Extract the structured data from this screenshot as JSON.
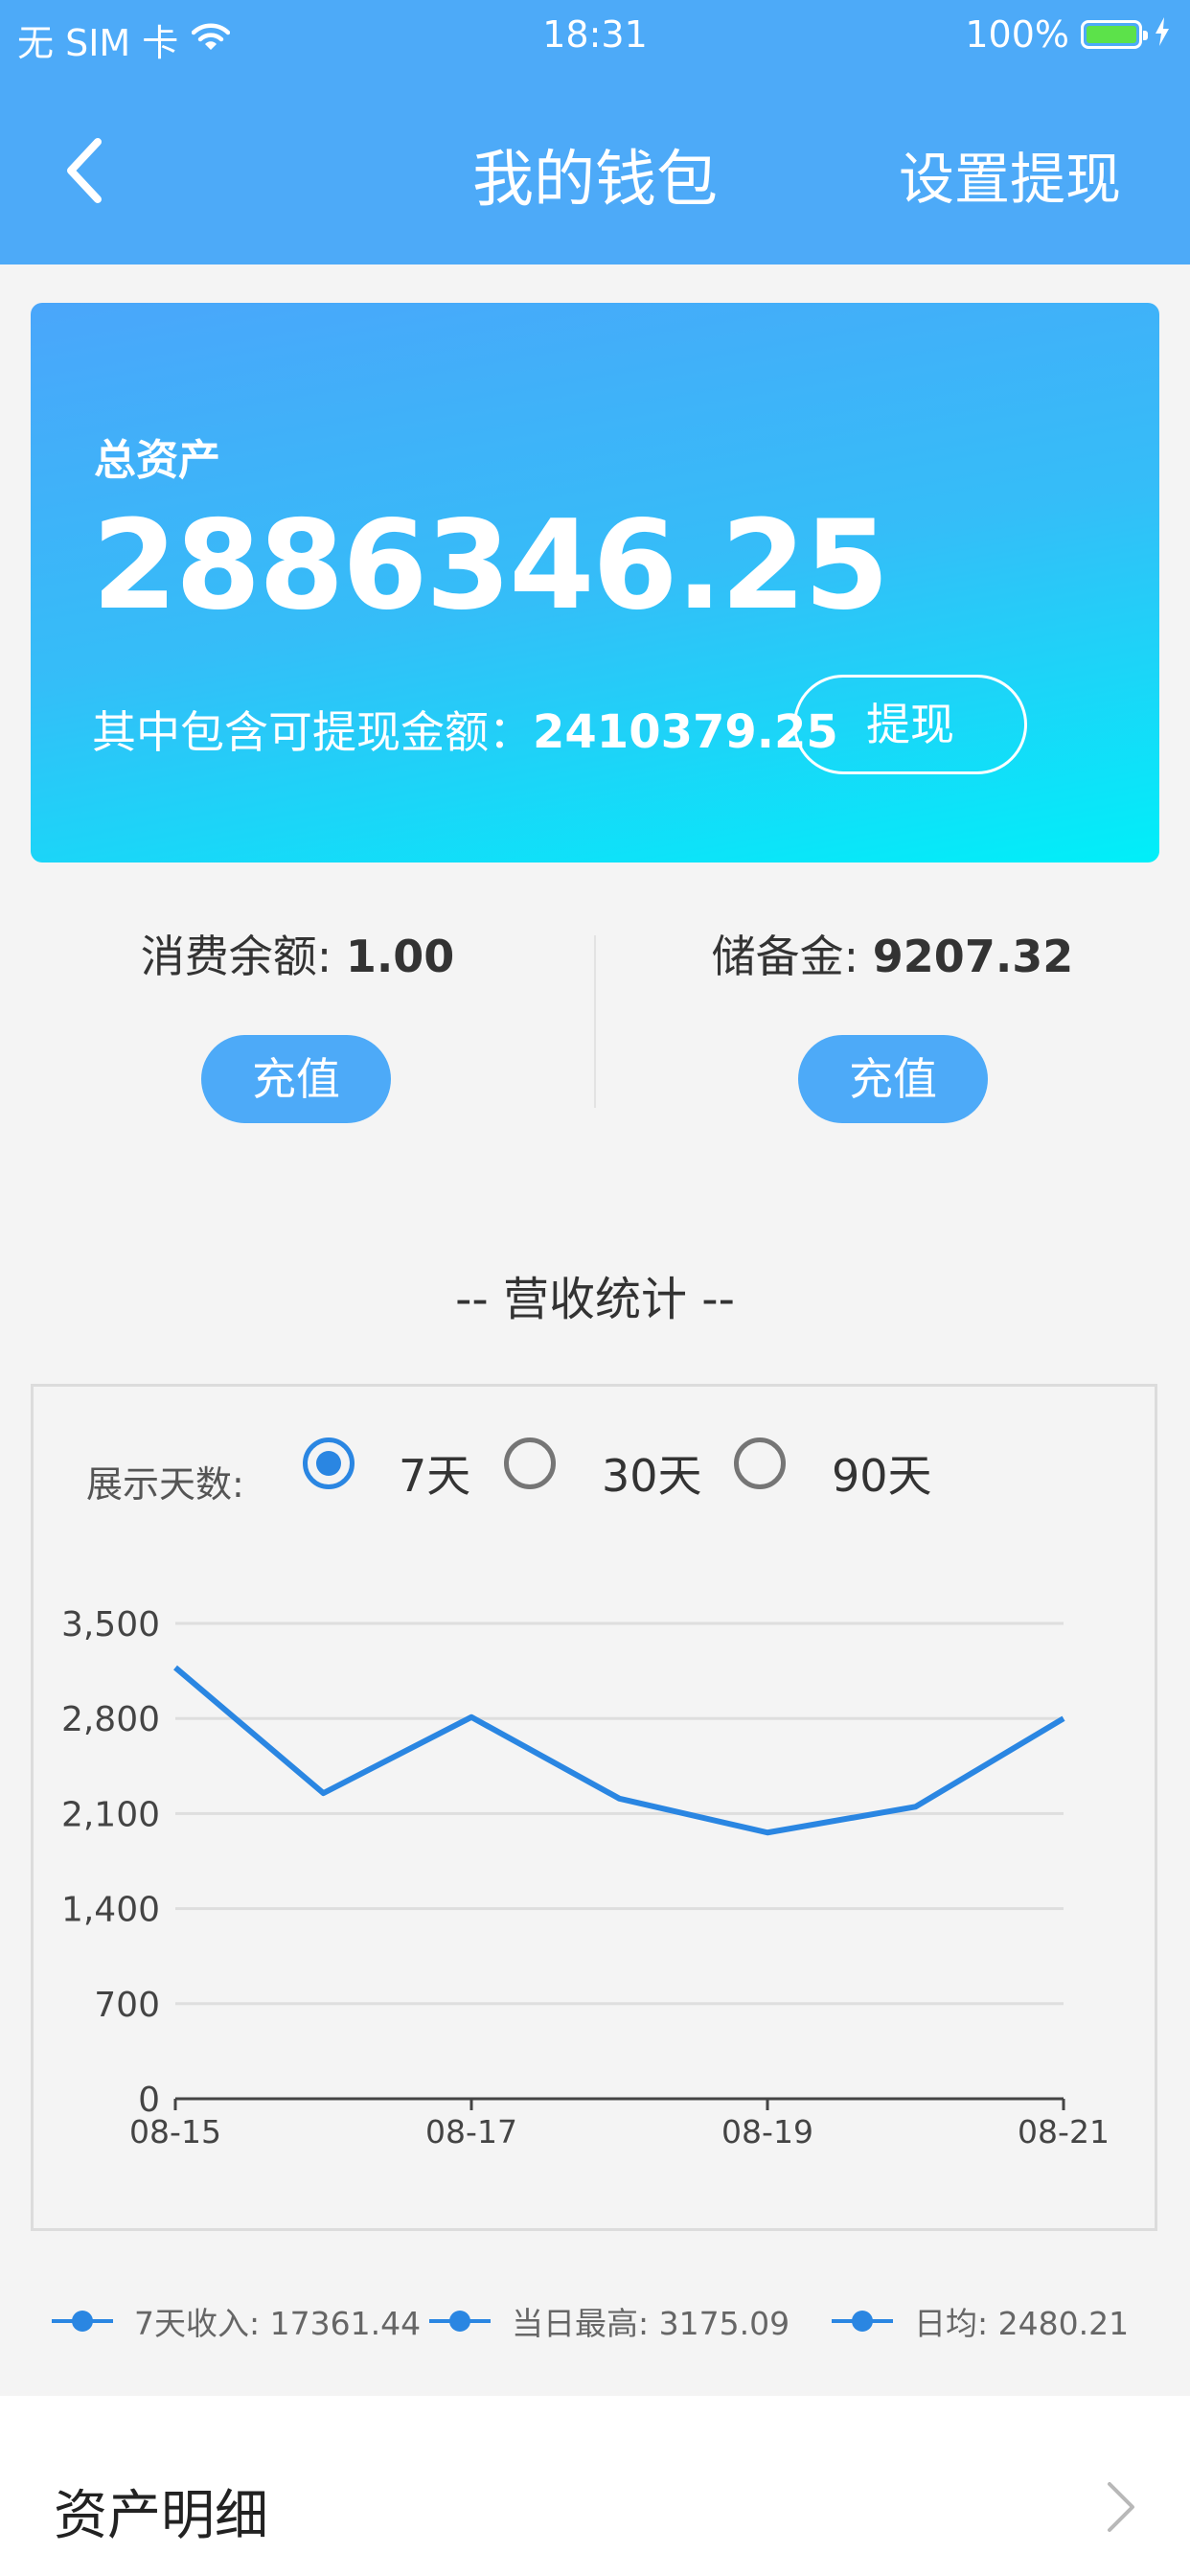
{
  "status_bar": {
    "carrier": "无 SIM 卡",
    "time": "18:31",
    "battery": "100%"
  },
  "nav": {
    "title": "我的钱包",
    "action": "设置提现"
  },
  "asset_card": {
    "label": "总资产",
    "total": "2886346.25",
    "withdrawable_label": "其中包含可提现金额：",
    "withdrawable_value": "2410379.25",
    "withdraw_button": "提现"
  },
  "balances": {
    "consume_label": "消费余额: ",
    "consume_value": "1.00",
    "reserve_label": "储备金: ",
    "reserve_value": "9207.32",
    "recharge_button": "充值"
  },
  "stats": {
    "title": "-- 营收统计 --",
    "days_label": "展示天数:",
    "options": [
      "7天",
      "30天",
      "90天"
    ],
    "selected": "7天"
  },
  "chart_data": {
    "type": "line",
    "x": [
      "08-15",
      "08-16",
      "08-17",
      "08-18",
      "08-19",
      "08-20",
      "08-21"
    ],
    "x_tick_labels": [
      "08-15",
      "08-17",
      "08-19",
      "08-21"
    ],
    "y_ticks": [
      "0",
      "700",
      "1,400",
      "2,100",
      "2,800",
      "3,500"
    ],
    "ylim": [
      0,
      3500
    ],
    "grid": true,
    "color": "#2a86e2",
    "series": [
      {
        "values": [
          3175,
          2250,
          2810,
          2210,
          1960,
          2150,
          2800
        ]
      }
    ]
  },
  "legend": {
    "items": [
      "7天收入: 17361.44",
      "当日最高: 3175.09",
      "日均: 2480.21"
    ]
  },
  "details": {
    "label": "资产明细"
  }
}
